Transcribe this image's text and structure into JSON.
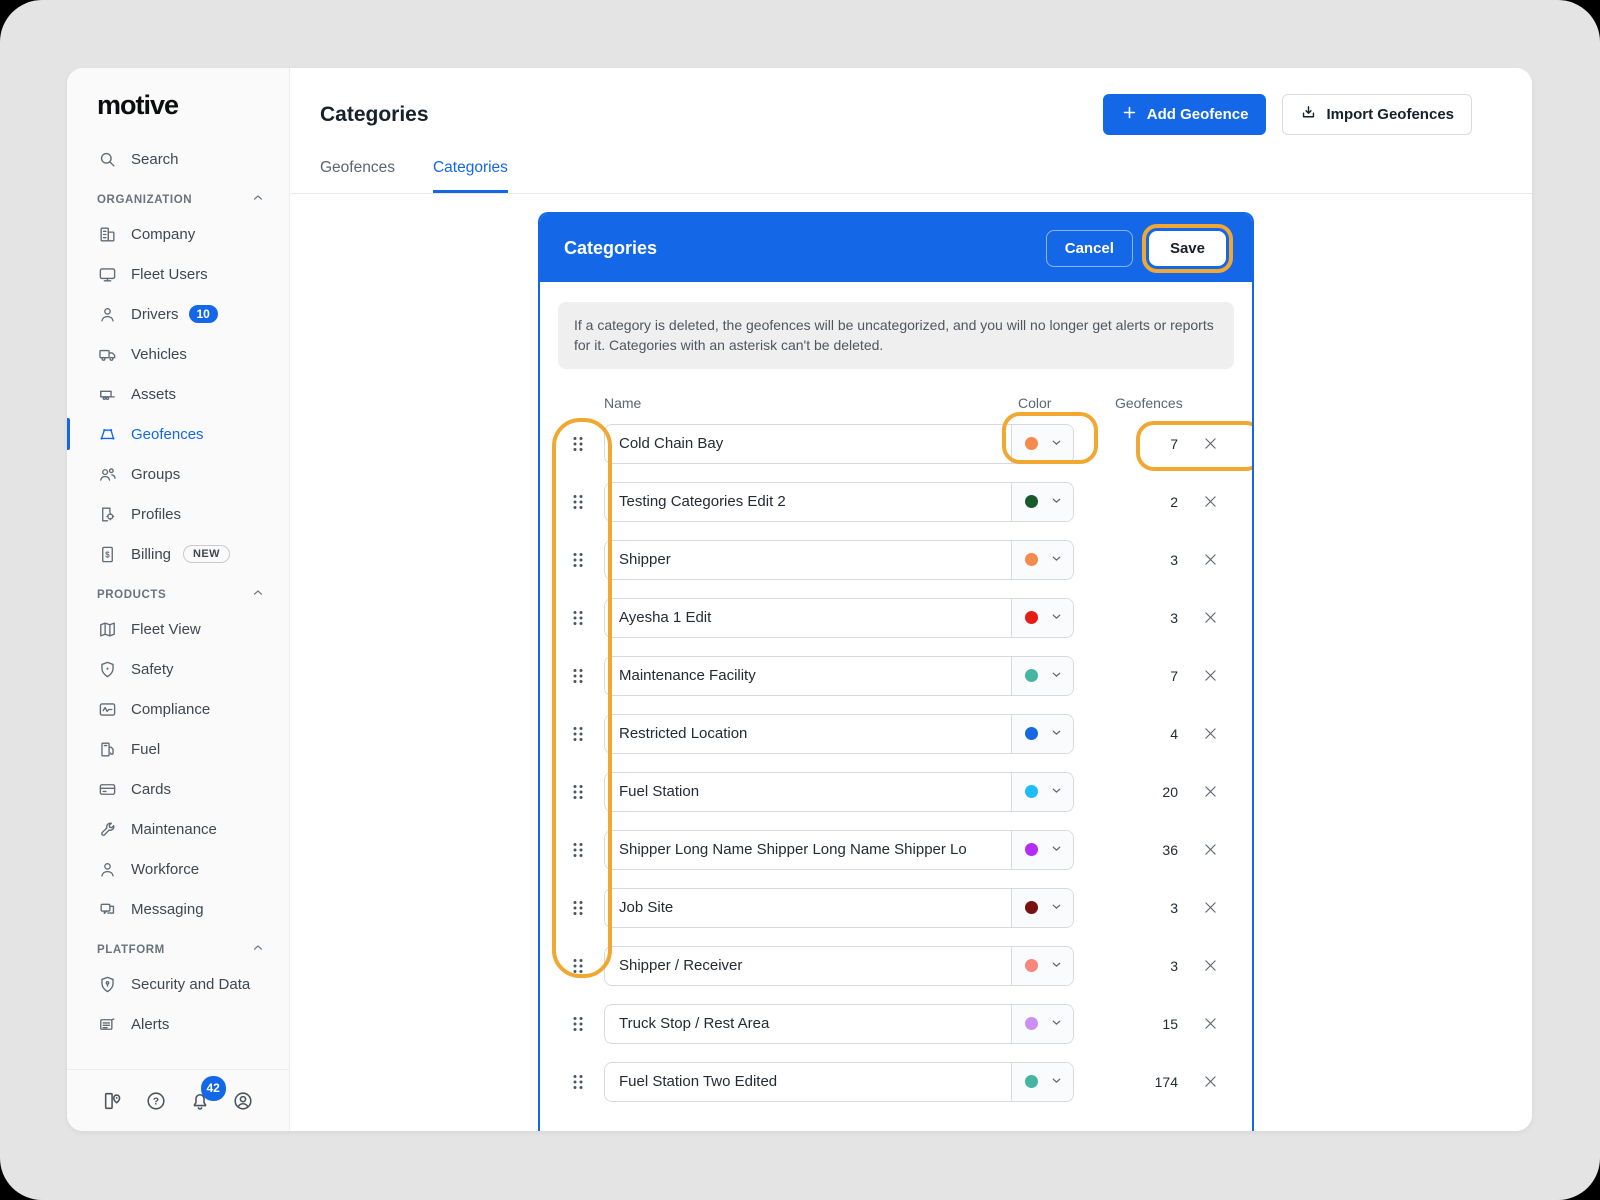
{
  "colors": {
    "accent_blue": "#1468E8",
    "annotation_orange": "#F0A832",
    "page_background": "#E4E4E4",
    "sidebar_background": "#FAFAFA",
    "info_box_background": "#EFEFEF"
  },
  "sidebar": {
    "logo": "motive",
    "search": {
      "label": "Search",
      "icon": "search"
    },
    "sections": [
      {
        "label": "ORGANIZATION",
        "items": [
          {
            "id": "company",
            "label": "Company",
            "icon": "company"
          },
          {
            "id": "fleet-users",
            "label": "Fleet Users",
            "icon": "monitor"
          },
          {
            "id": "drivers",
            "label": "Drivers",
            "icon": "person",
            "badge": {
              "type": "count",
              "text": "10"
            }
          },
          {
            "id": "vehicles",
            "label": "Vehicles",
            "icon": "truck"
          },
          {
            "id": "assets",
            "label": "Assets",
            "icon": "trailer"
          },
          {
            "id": "geofences",
            "label": "Geofences",
            "icon": "geofence",
            "active": true
          },
          {
            "id": "groups",
            "label": "Groups",
            "icon": "people"
          },
          {
            "id": "profiles",
            "label": "Profiles",
            "icon": "profile-gear"
          },
          {
            "id": "billing",
            "label": "Billing",
            "icon": "billing",
            "badge": {
              "type": "new",
              "text": "NEW"
            }
          }
        ]
      },
      {
        "label": "PRODUCTS",
        "items": [
          {
            "id": "fleet-view",
            "label": "Fleet View",
            "icon": "map"
          },
          {
            "id": "safety",
            "label": "Safety",
            "icon": "shield"
          },
          {
            "id": "compliance",
            "label": "Compliance",
            "icon": "compliance"
          },
          {
            "id": "fuel",
            "label": "Fuel",
            "icon": "fuel"
          },
          {
            "id": "cards",
            "label": "Cards",
            "icon": "card"
          },
          {
            "id": "maintenance",
            "label": "Maintenance",
            "icon": "wrench"
          },
          {
            "id": "workforce",
            "label": "Workforce",
            "icon": "person"
          },
          {
            "id": "messaging",
            "label": "Messaging",
            "icon": "chat"
          }
        ]
      },
      {
        "label": "PLATFORM",
        "items": [
          {
            "id": "security-and-data",
            "label": "Security and Data",
            "icon": "shield-lock"
          },
          {
            "id": "alerts",
            "label": "Alerts",
            "icon": "alerts"
          }
        ]
      }
    ],
    "footer": {
      "icons": [
        "guide",
        "help",
        "bell",
        "account"
      ],
      "notification_count": "42"
    }
  },
  "header": {
    "title": "Categories",
    "tabs": [
      {
        "label": "Geofences",
        "active": false
      },
      {
        "label": "Categories",
        "active": true
      }
    ],
    "add_button": "Add Geofence",
    "import_button": "Import Geofences"
  },
  "modal": {
    "title": "Categories",
    "cancel_label": "Cancel",
    "save_label": "Save",
    "info": "If a category is deleted, the geofences will be uncategorized, and you will no longer get alerts or reports for it. Categories with an asterisk can't be deleted.",
    "columns": {
      "name": "Name",
      "color": "Color",
      "geofences": "Geofences"
    },
    "rows": [
      {
        "name": "Cold Chain Bay",
        "color": "#F58A4F",
        "geofences": "7"
      },
      {
        "name": "Testing Categories Edit 2",
        "color": "#175B2D",
        "geofences": "2"
      },
      {
        "name": "Shipper",
        "color": "#F58A4F",
        "geofences": "3"
      },
      {
        "name": "Ayesha 1 Edit",
        "color": "#E41D16",
        "geofences": "3"
      },
      {
        "name": "Maintenance Facility",
        "color": "#46B5A2",
        "geofences": "7"
      },
      {
        "name": "Restricted Location",
        "color": "#1767E3",
        "geofences": "4"
      },
      {
        "name": "Fuel Station",
        "color": "#1FBDF8",
        "geofences": "20"
      },
      {
        "name": "Shipper Long Name Shipper Long Name Shipper Lo",
        "color": "#B32CF5",
        "geofences": "36"
      },
      {
        "name": "Job Site",
        "color": "#7A1111",
        "geofences": "3"
      },
      {
        "name": "Shipper / Receiver",
        "color": "#F9867D",
        "geofences": "3"
      },
      {
        "name": "Truck Stop / Rest Area",
        "color": "#CC8EF5",
        "geofences": "15"
      },
      {
        "name": "Fuel Station Two Edited",
        "color": "#46B5A2",
        "geofences": "174"
      }
    ],
    "annotations": {
      "highlighted_handle_rows": 10,
      "highlighted_row_color_select": 1,
      "highlighted_row_count": 1,
      "save_button_highlighted": true
    }
  }
}
